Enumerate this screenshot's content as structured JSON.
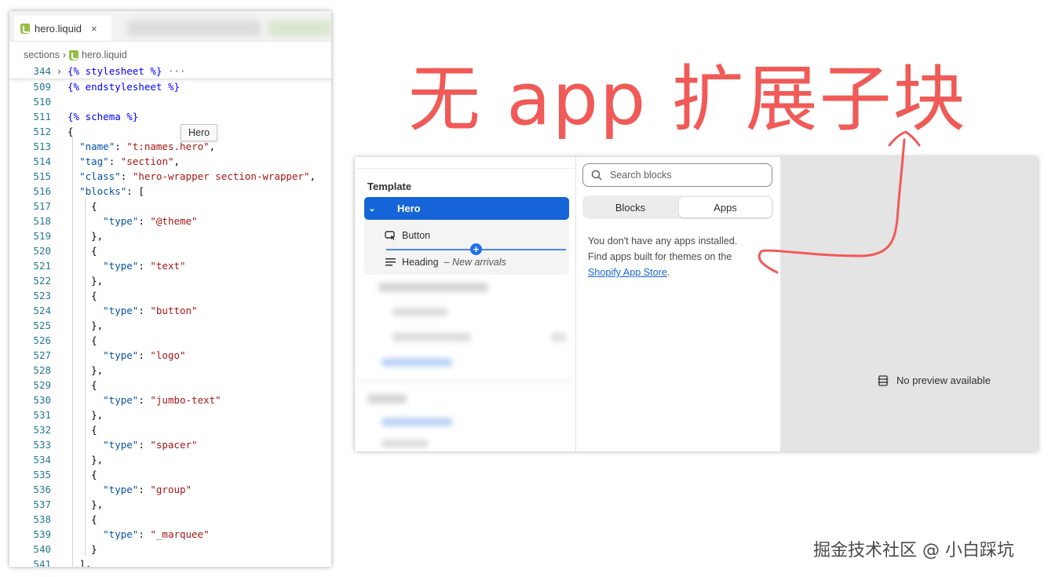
{
  "editor": {
    "tab_label": "hero.liquid",
    "tab_close": "×",
    "breadcrumb": [
      "sections",
      "hero.liquid"
    ],
    "hover_tooltip": "Hero",
    "lines": [
      {
        "n": "344",
        "t": "{% stylesheet %}",
        "extra": "···",
        "sticky": true,
        "fold": "›"
      },
      {
        "n": "509",
        "t": "{% endstylesheet %}"
      },
      {
        "n": "510",
        "t": ""
      },
      {
        "n": "511",
        "t": "{% schema %}"
      },
      {
        "n": "512",
        "t": "{"
      },
      {
        "n": "513",
        "t": "  \"name\": \"t:names.hero\","
      },
      {
        "n": "514",
        "t": "  \"tag\": \"section\","
      },
      {
        "n": "515",
        "t": "  \"class\": \"hero-wrapper section-wrapper\","
      },
      {
        "n": "516",
        "t": "  \"blocks\": ["
      },
      {
        "n": "517",
        "t": "    {"
      },
      {
        "n": "518",
        "t": "      \"type\": \"@theme\""
      },
      {
        "n": "519",
        "t": "    },"
      },
      {
        "n": "520",
        "t": "    {"
      },
      {
        "n": "521",
        "t": "      \"type\": \"text\""
      },
      {
        "n": "522",
        "t": "    },"
      },
      {
        "n": "523",
        "t": "    {"
      },
      {
        "n": "524",
        "t": "      \"type\": \"button\""
      },
      {
        "n": "525",
        "t": "    },"
      },
      {
        "n": "526",
        "t": "    {"
      },
      {
        "n": "527",
        "t": "      \"type\": \"logo\""
      },
      {
        "n": "528",
        "t": "    },"
      },
      {
        "n": "529",
        "t": "    {"
      },
      {
        "n": "530",
        "t": "      \"type\": \"jumbo-text\""
      },
      {
        "n": "531",
        "t": "    },"
      },
      {
        "n": "532",
        "t": "    {"
      },
      {
        "n": "533",
        "t": "      \"type\": \"spacer\""
      },
      {
        "n": "534",
        "t": "    },"
      },
      {
        "n": "535",
        "t": "    {"
      },
      {
        "n": "536",
        "t": "      \"type\": \"group\""
      },
      {
        "n": "537",
        "t": "    },"
      },
      {
        "n": "538",
        "t": "    {"
      },
      {
        "n": "539",
        "t": "      \"type\": \"_marquee\""
      },
      {
        "n": "540",
        "t": "    }"
      },
      {
        "n": "541",
        "t": "  ],"
      }
    ]
  },
  "annotation": {
    "title": "无 app 扩展子块",
    "color": "#f05a57"
  },
  "shopify": {
    "template_label": "Template",
    "hero_label": "Hero",
    "button_block": "Button",
    "heading_block": "Heading",
    "heading_suffix": "– New arrivals",
    "search_placeholder": "Search blocks",
    "tabs": {
      "blocks": "Blocks",
      "apps": "Apps"
    },
    "message_line1": "You don't have any apps installed.",
    "message_line2": "Find apps built for themes on the",
    "app_store_link": "Shopify App Store",
    "message_end": ".",
    "preview_text": "No preview available",
    "accent": "#1565d8"
  },
  "watermark": "掘金技术社区 @ 小白踩坑"
}
